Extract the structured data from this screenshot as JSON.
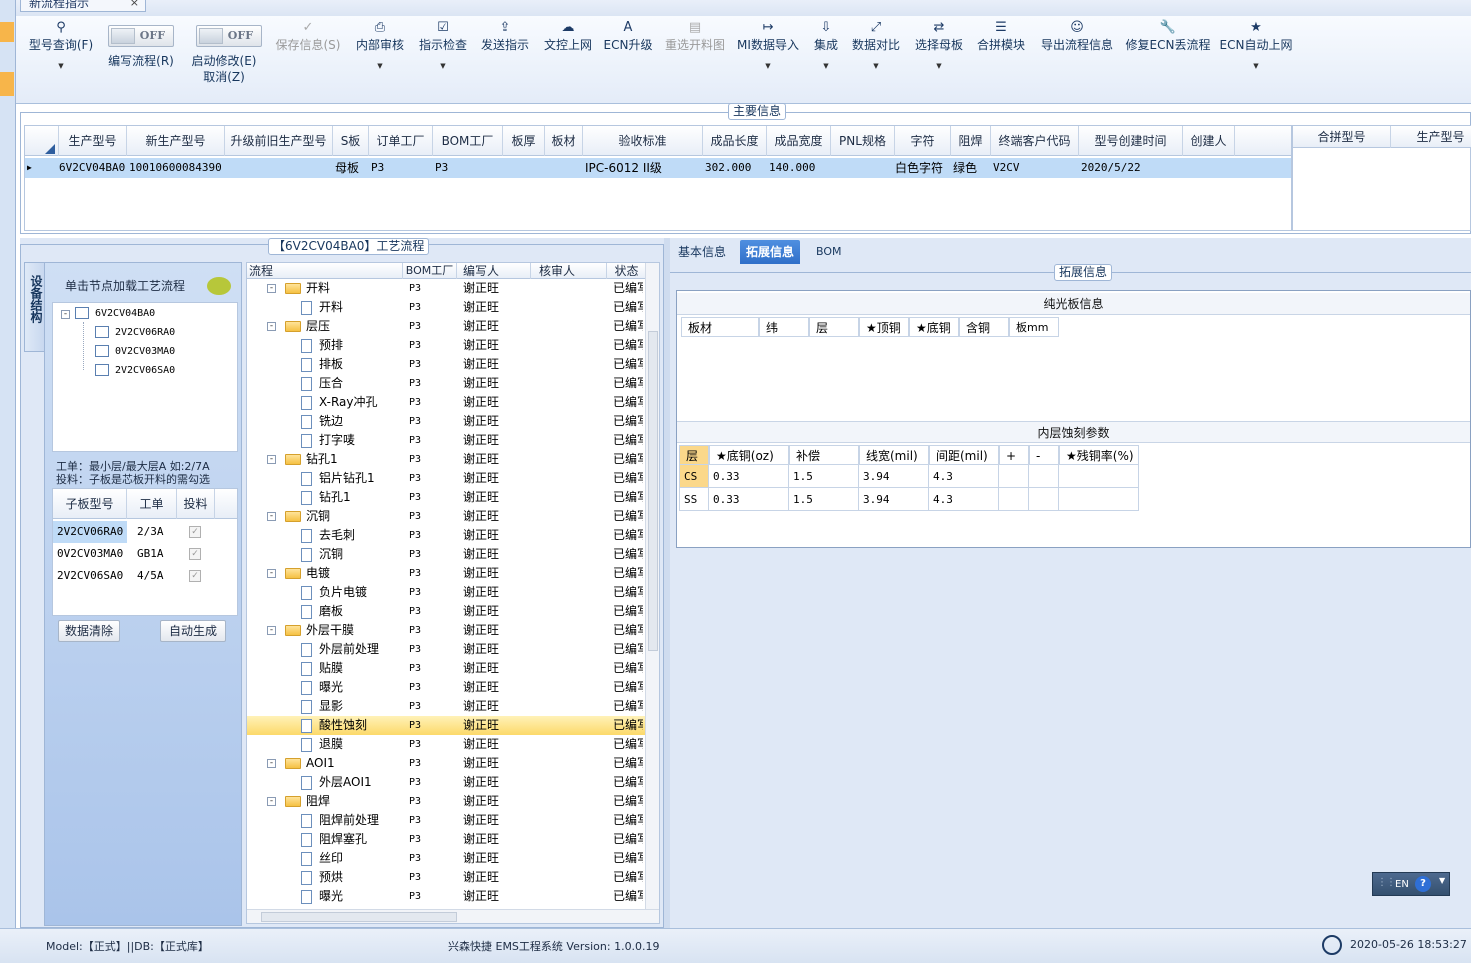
{
  "window": {
    "tab_title": "新流程指示",
    "close": "×"
  },
  "ribbon": {
    "query": "型号查询(F)",
    "edit_flow": "编写流程(R)",
    "enable_edit": "启动修改(E)",
    "cancel": "取消(Z)",
    "toggle_off": "OFF",
    "save": "保存信息(S)",
    "internal_review": "内部审核",
    "check_instr": "指示检查",
    "send_instr": "发送指示",
    "text_upload": "文控上网",
    "ecn_upgrade": "ECN升级",
    "reselect_map": "重选开料图",
    "mi_import": "MI数据导入",
    "integrate": "集成",
    "data_compare": "数据对比",
    "select_mother": "选择母板",
    "merge_module": "合拼模块",
    "export_flow": "导出流程信息",
    "fix_ecn": "修复ECN丢流程",
    "ecn_auto": "ECN自动上网"
  },
  "main_info": {
    "title": "主要信息",
    "columns": [
      "生产型号",
      "新生产型号",
      "升级前旧生产型号",
      "S板",
      "订单工厂",
      "BOM工厂",
      "板厚",
      "板材",
      "验收标准",
      "成品长度",
      "成品宽度",
      "PNL规格",
      "字符",
      "阻焊",
      "终端客户代码",
      "型号创建时间",
      "创建人"
    ],
    "row": {
      "prod_model": "6V2CV04BA0",
      "new_prod_model": "10010600084390",
      "old_model": "",
      "s_board": "母板",
      "order_factory": "P3",
      "bom_factory": "P3",
      "thickness": "",
      "material": "",
      "standard": "IPC-6012 II级",
      "length": "302.000",
      "width": "140.000",
      "pnl": "",
      "character": "白色字符",
      "solder_mask": "绿色",
      "customer_code": "V2CV",
      "created": "2020/5/22",
      "creator": ""
    },
    "side_columns": [
      "合拼型号",
      "生产型号"
    ]
  },
  "flow": {
    "title": "【6V2CV04BA0】工艺流程",
    "device_tab": "设备结构",
    "hint": "单击节点加载工艺流程",
    "tree_root": "6V2CV04BA0",
    "tree_children": [
      "2V2CV06RA0",
      "0V2CV03MA0",
      "2V2CV06SA0"
    ],
    "note1": "工单：最小层/最大层A 如:2/7A",
    "note2": "投料：子板是芯板开料的需勾选",
    "sub_columns": [
      "子板型号",
      "工单",
      "投料"
    ],
    "sub_rows": [
      {
        "model": "2V2CV06RA0",
        "order": "2/3A"
      },
      {
        "model": "0V2CV03MA0",
        "order": "GB1A"
      },
      {
        "model": "2V2CV06SA0",
        "order": "4/5A"
      }
    ],
    "btn_clear": "数据清除",
    "btn_auto": "自动生成",
    "proc_columns": [
      "流程",
      "BOM工厂",
      "编写人",
      "核审人",
      "状态"
    ],
    "factory": "P3",
    "writer": "谢正旺",
    "status": "已编写",
    "proc_rows": [
      {
        "name": "开料",
        "group": true
      },
      {
        "name": "开料",
        "group": false
      },
      {
        "name": "层压",
        "group": true
      },
      {
        "name": "预排",
        "group": false
      },
      {
        "name": "排板",
        "group": false
      },
      {
        "name": "压合",
        "group": false
      },
      {
        "name": "X-Ray冲孔",
        "group": false
      },
      {
        "name": "铣边",
        "group": false
      },
      {
        "name": "打字唛",
        "group": false
      },
      {
        "name": "钻孔1",
        "group": true
      },
      {
        "name": "铝片钻孔1",
        "group": false
      },
      {
        "name": "钻孔1",
        "group": false
      },
      {
        "name": "沉铜",
        "group": true
      },
      {
        "name": "去毛刺",
        "group": false
      },
      {
        "name": "沉铜",
        "group": false
      },
      {
        "name": "电镀",
        "group": true
      },
      {
        "name": "负片电镀",
        "group": false
      },
      {
        "name": "磨板",
        "group": false
      },
      {
        "name": "外层干膜",
        "group": true
      },
      {
        "name": "外层前处理",
        "group": false
      },
      {
        "name": "贴膜",
        "group": false
      },
      {
        "name": "曝光",
        "group": false
      },
      {
        "name": "显影",
        "group": false
      },
      {
        "name": "酸性蚀刻",
        "group": false,
        "selected": true
      },
      {
        "name": "退膜",
        "group": false
      },
      {
        "name": "AOI1",
        "group": true
      },
      {
        "name": "外层AOI1",
        "group": false
      },
      {
        "name": "阻焊",
        "group": true
      },
      {
        "name": "阻焊前处理",
        "group": false
      },
      {
        "name": "阻焊塞孔",
        "group": false
      },
      {
        "name": "丝印",
        "group": false
      },
      {
        "name": "预烘",
        "group": false
      },
      {
        "name": "曝光",
        "group": false
      }
    ]
  },
  "right": {
    "tabs": [
      "基本信息",
      "拓展信息",
      "BOM"
    ],
    "ext_title": "拓展信息",
    "pure_title": "纯光板信息",
    "pure_columns": [
      "板材",
      "纬",
      "层",
      "★顶铜",
      "★底铜",
      "含铜",
      "板mm"
    ],
    "etch_title": "内层蚀刻参数",
    "etch_columns": [
      "层",
      "★底铜(oz)",
      "补偿",
      "线宽(mil)",
      "间距(mil)",
      "+",
      "-",
      "★残铜率(%)"
    ],
    "etch_rows": [
      {
        "layer": "CS",
        "copper": "0.33",
        "comp": "1.5",
        "width": "3.94",
        "gap": "4.3"
      },
      {
        "layer": "SS",
        "copper": "0.33",
        "comp": "1.5",
        "width": "3.94",
        "gap": "4.3"
      }
    ],
    "lang": "EN"
  },
  "status": {
    "model": "Model:【正式】||DB:【正式库】",
    "system": "兴森快捷 EMS工程系统 Version: 1.0.0.19",
    "datetime": "2020-05-26 18:53:27"
  }
}
